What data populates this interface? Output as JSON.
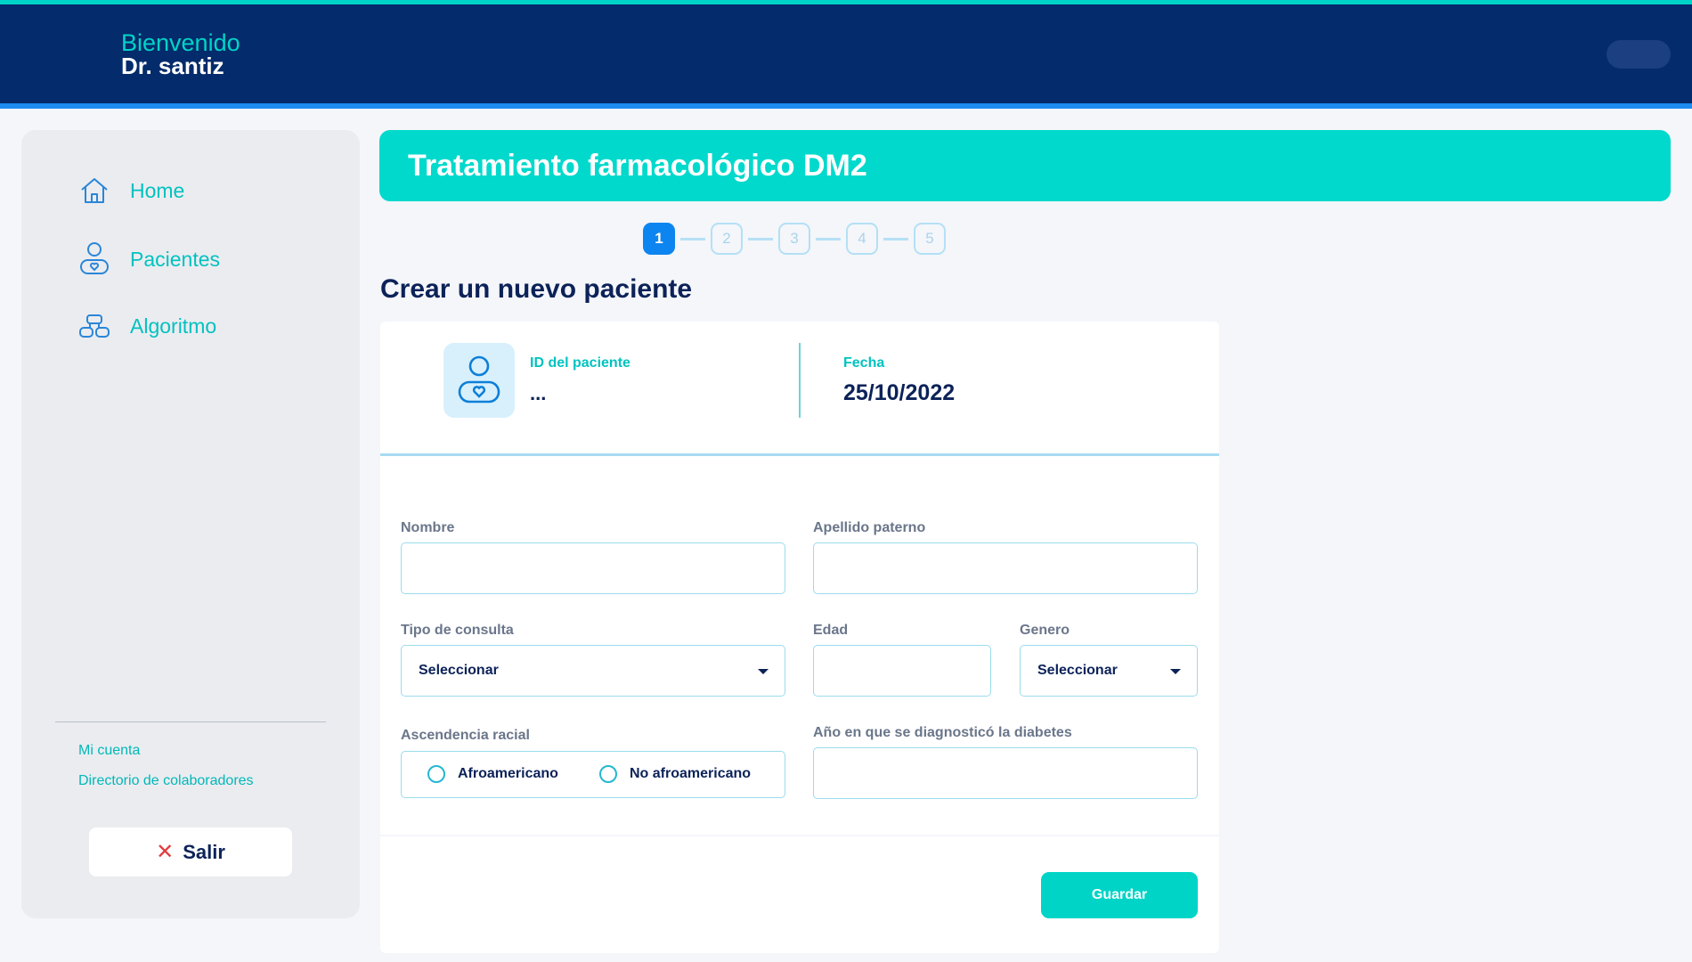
{
  "header": {
    "greeting": "Bienvenido",
    "doctor_name": "Dr. santiz"
  },
  "sidebar": {
    "items": [
      {
        "label": "Home",
        "icon": "home-icon"
      },
      {
        "label": "Pacientes",
        "icon": "patient-icon"
      },
      {
        "label": "Algoritmo",
        "icon": "algorithm-icon"
      }
    ],
    "links": [
      {
        "label": "Mi cuenta"
      },
      {
        "label": "Directorio de colaboradores"
      }
    ],
    "logout_label": "Salir"
  },
  "banner": {
    "title": "Tratamiento farmacológico DM2"
  },
  "stepper": {
    "steps": [
      "1",
      "2",
      "3",
      "4",
      "5"
    ],
    "active_step": "1"
  },
  "page": {
    "title": "Crear un nuevo paciente"
  },
  "patient_info": {
    "id_label": "ID del paciente",
    "id_value": "...",
    "date_label": "Fecha",
    "date_value": "25/10/2022"
  },
  "form": {
    "nombre_label": "Nombre",
    "apellido_label": "Apellido paterno",
    "tipo_consulta_label": "Tipo de consulta",
    "tipo_consulta_value": "Seleccionar",
    "edad_label": "Edad",
    "genero_label": "Genero",
    "genero_value": "Seleccionar",
    "ascendencia_label": "Ascendencia racial",
    "ascendencia_options": [
      "Afroamericano",
      "No afroamericano"
    ],
    "diagnostico_label": "Año en que se diagnosticó la diabetes",
    "save_label": "Guardar"
  },
  "colors": {
    "navy": "#042b6b",
    "teal": "#00d4c7",
    "blue": "#0d85f0",
    "text_dark": "#0c2258"
  }
}
